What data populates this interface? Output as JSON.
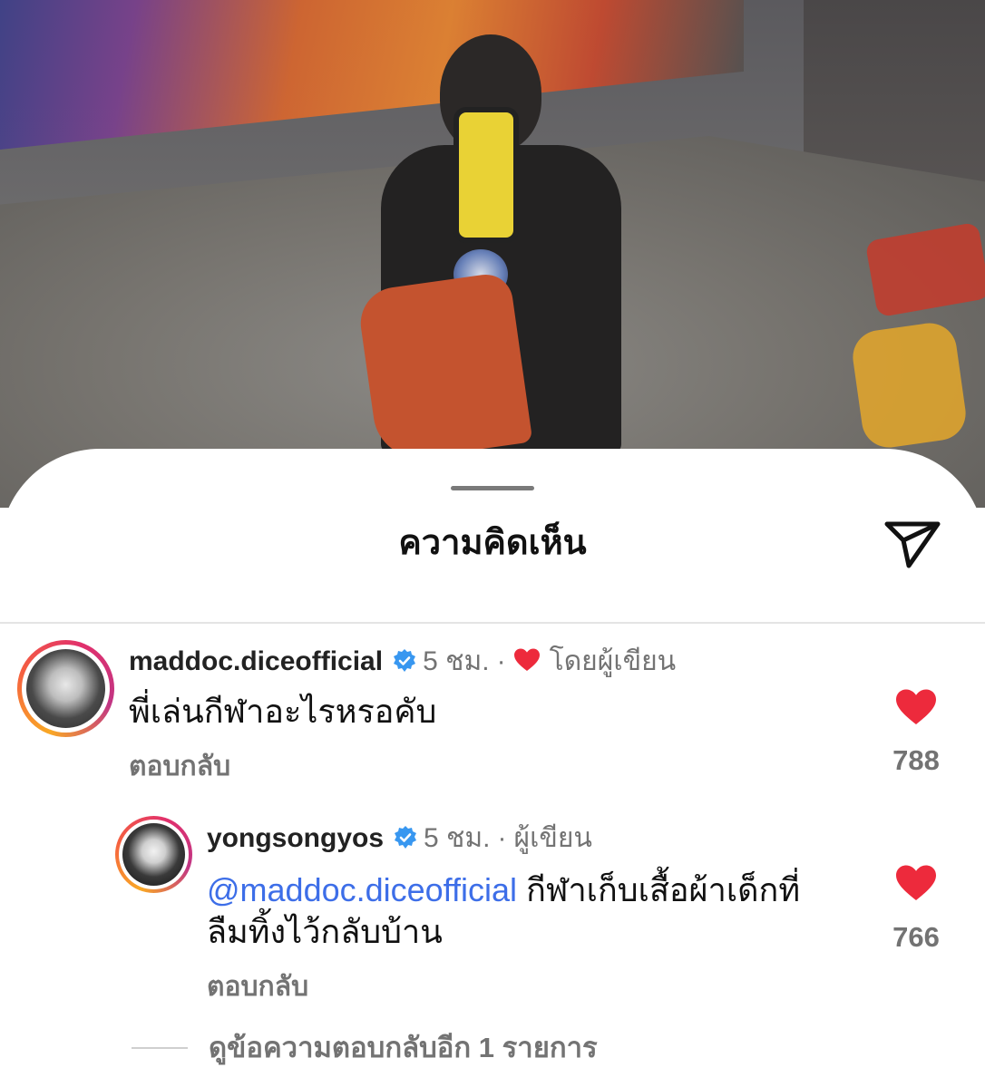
{
  "sheet": {
    "title": "ความคิดเห็น",
    "send_icon": "paper-plane-icon"
  },
  "comments": [
    {
      "username": "maddoc.diceofficial",
      "verified": true,
      "time": "5 ชม.",
      "separator": "·",
      "author_liked_label": "โดยผู้เขียน",
      "text": "พี่เล่นกีฬาอะไรหรอคับ",
      "reply_label": "ตอบกลับ",
      "likes": "788"
    },
    {
      "username": "yongsongyos",
      "verified": true,
      "time": "5 ชม.",
      "separator": "·",
      "author_label": "ผู้เขียน",
      "mention": "@maddoc.diceofficial",
      "text_line1": " กีฬาเก็บเสื้อผ้าเด็กที่",
      "text_line2": "ลืมทิ้งไว้กลับบ้าน",
      "reply_label": "ตอบกลับ",
      "likes": "766"
    }
  ],
  "view_more_replies": "ดูข้อความตอบกลับอีก 1 รายการ",
  "colors": {
    "like_red": "#ed2a3c",
    "verified_blue": "#3897f0",
    "mention_blue": "#3d6ee8",
    "secondary_text": "#737373"
  }
}
